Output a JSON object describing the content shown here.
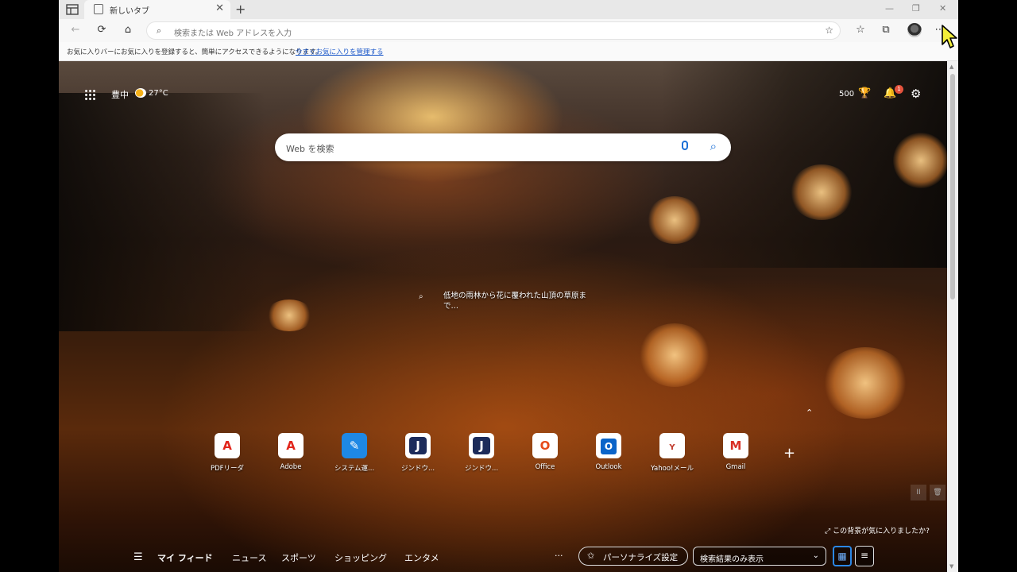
{
  "tab": {
    "title": "新しいタブ",
    "close": "✕",
    "new": "+"
  },
  "window": {
    "minimize": "—",
    "maximize": "❐",
    "close": "✕"
  },
  "toolbar": {
    "back": "←",
    "refresh": "⟳",
    "home": "⌂",
    "address_placeholder": "検索または Web アドレスを入力",
    "add_favorite": "☆",
    "favorites": "☆",
    "collections": "⧉",
    "menu": "⋯"
  },
  "favbar": {
    "message": "お気に入りバーにお気に入りを登録すると、簡単にアクセスできるようになります。",
    "link": "今すぐお気に入りを管理する"
  },
  "ntp": {
    "location": "豊中",
    "temperature": "27°C",
    "points": "500",
    "notification_count": "1",
    "search_placeholder": "Web を検索",
    "image_caption": "低地の雨林から花に覆われた山頂の草原まで…",
    "quicklinks": [
      {
        "label": "PDFリーダ",
        "glyph": "A",
        "color": "#e1251b"
      },
      {
        "label": "Adobe",
        "glyph": "A",
        "color": "#e1251b"
      },
      {
        "label": "システム運...",
        "glyph": "✎",
        "color": "#1e88e5"
      },
      {
        "label": "ジンドウ...",
        "glyph": "J",
        "color": "#1c2b5a"
      },
      {
        "label": "ジンドウ...",
        "glyph": "J",
        "color": "#1c2b5a"
      },
      {
        "label": "Office",
        "glyph": "O",
        "color": "#e64a19"
      },
      {
        "label": "Outlook",
        "glyph": "O",
        "color": "#0a64c9"
      },
      {
        "label": "Yahoo!メール",
        "glyph": "Y",
        "color": "#c0392b"
      },
      {
        "label": "Gmail",
        "glyph": "M",
        "color": "#d93025"
      }
    ],
    "add_quicklink": "+",
    "like_background": "この背景が気に入りましたか?"
  },
  "feedbar": {
    "my_feed": "マイ フィード",
    "news": "ニュース",
    "sports": "スポーツ",
    "shopping": "ショッピング",
    "entertainment": "エンタメ",
    "more": "···",
    "personalize": "パーソナライズ設定",
    "view_option": "検索結果のみ表示",
    "pause": "II",
    "trash": "🗑"
  },
  "colors": {
    "accent": "#1a6fd6",
    "link": "#1a57c9"
  }
}
